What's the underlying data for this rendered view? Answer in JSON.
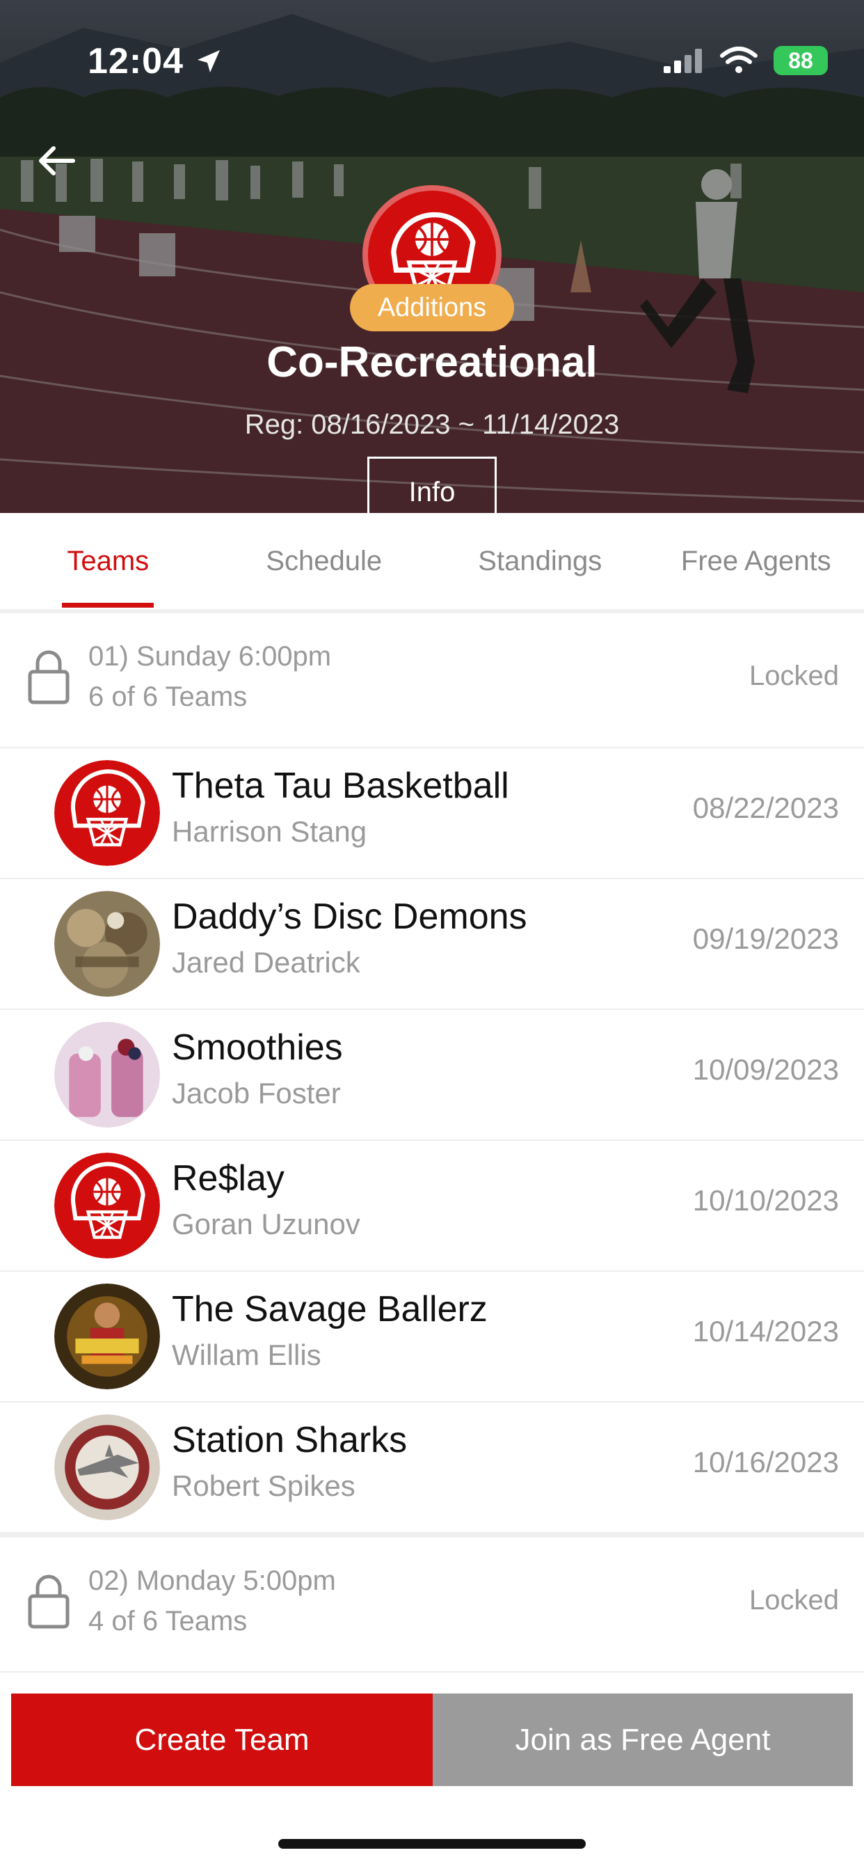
{
  "status_bar": {
    "time": "12:04",
    "battery": "88"
  },
  "header": {
    "badge": "Additions",
    "title": "Co-Recreational",
    "registration": "Reg: 08/16/2023 ~ 11/14/2023",
    "info_button": "Info"
  },
  "tabs": [
    {
      "label": "Teams",
      "active": true
    },
    {
      "label": "Schedule",
      "active": false
    },
    {
      "label": "Standings",
      "active": false
    },
    {
      "label": "Free Agents",
      "active": false
    }
  ],
  "divisions": [
    {
      "title": "01) Sunday 6:00pm",
      "count": "6 of 6 Teams",
      "status": "Locked",
      "teams": [
        {
          "name": "Theta Tau Basketball",
          "captain": "Harrison Stang",
          "date": "08/22/2023",
          "avatar": "league-logo"
        },
        {
          "name": "Daddy’s Disc Demons",
          "captain": "Jared Deatrick",
          "date": "09/19/2023",
          "avatar": "photo"
        },
        {
          "name": "Smoothies",
          "captain": "Jacob Foster",
          "date": "10/09/2023",
          "avatar": "photo"
        },
        {
          "name": "Re$lay",
          "captain": "Goran Uzunov",
          "date": "10/10/2023",
          "avatar": "league-logo"
        },
        {
          "name": "The Savage Ballerz",
          "captain": "Willam Ellis",
          "date": "10/14/2023",
          "avatar": "photo"
        },
        {
          "name": "Station Sharks",
          "captain": "Robert Spikes",
          "date": "10/16/2023",
          "avatar": "photo"
        }
      ]
    },
    {
      "title": "02) Monday 5:00pm",
      "count": "4 of 6 Teams",
      "status": "Locked",
      "teams": []
    }
  ],
  "actions": {
    "create_team": "Create Team",
    "join_free_agent": "Join as Free Agent"
  },
  "colors": {
    "accent": "#d10d0d",
    "badge": "#f0ad4e",
    "secondary_button": "#9b9b9b"
  }
}
